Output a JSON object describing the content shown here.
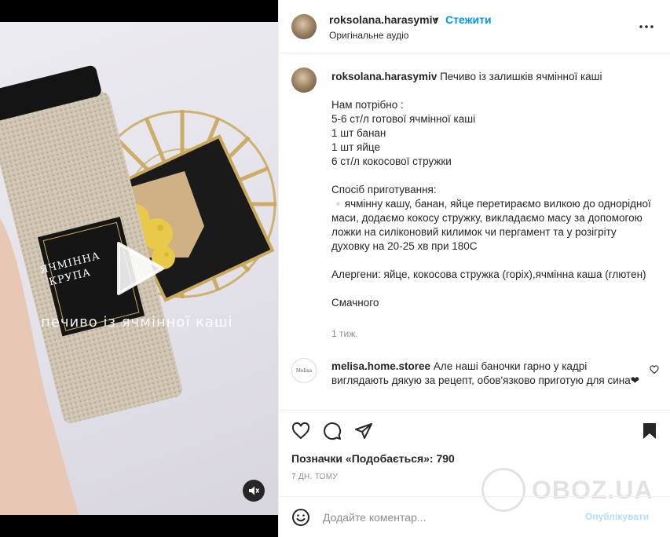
{
  "media": {
    "overlay_text": "печиво із ячмінної каші",
    "jar_label_line1": "ЯЧМІННА",
    "jar_label_line2": "КРУПА",
    "play_icon": "play-icon",
    "mute_icon": "muted-speaker-icon"
  },
  "header": {
    "username": "roksolana.harasymiv",
    "separator": "•",
    "follow_label": "Стежити",
    "audio_label": "Оригінальне аудіо",
    "more_icon": "more-dots-icon"
  },
  "caption": {
    "username": "roksolana.harasymiv",
    "title": "Печиво із залишків ячмінної каші",
    "lines": [
      "",
      "Нам потрібно :",
      "5-6 ст/л готової ячмінної каші",
      "1 шт банан",
      "1 шт яйце",
      "6 ст/л кокосової стружки",
      "",
      "Спосіб приготування:",
      "▫️ячмінну кашу, банан, яйце перетираємо вилкою до однорідної маси, додаємо кокосу стружку, викладаємо масу за допомогою ложки на силіконовий килимок чи пергамент та у розігріту духовку на 20-25 хв при 180С",
      "",
      "Алергени: яйце, кокосова стружка (горіх),ячмінна каша (глютен)",
      "",
      "Смачного"
    ],
    "time": "1 тиж."
  },
  "comment": {
    "username": "melisa.home.storee",
    "text": "Але наші баночки гарно у кадрі виглядають дякую за рецепт, обов'язково приготую для сина❤",
    "avatar_text": "Melisa",
    "like_icon": "heart-outline-icon"
  },
  "actions": {
    "like_icon": "heart-icon",
    "comment_icon": "comment-bubble-icon",
    "share_icon": "paper-plane-icon",
    "save_icon": "bookmark-icon",
    "likes_text": "Позначки «Подобається»: 790",
    "date_text": "7 ДН. ТОМУ"
  },
  "add_comment": {
    "emoji_icon": "emoji-smile-icon",
    "placeholder": "Додайте коментар...",
    "publish_label": "Опублікувати"
  },
  "watermark": {
    "text": "OBOZ.UA"
  },
  "colors": {
    "accent": "#0095f6",
    "publish_disabled": "#b2dffc",
    "text": "#262626",
    "secondary": "#8e8e8e"
  }
}
